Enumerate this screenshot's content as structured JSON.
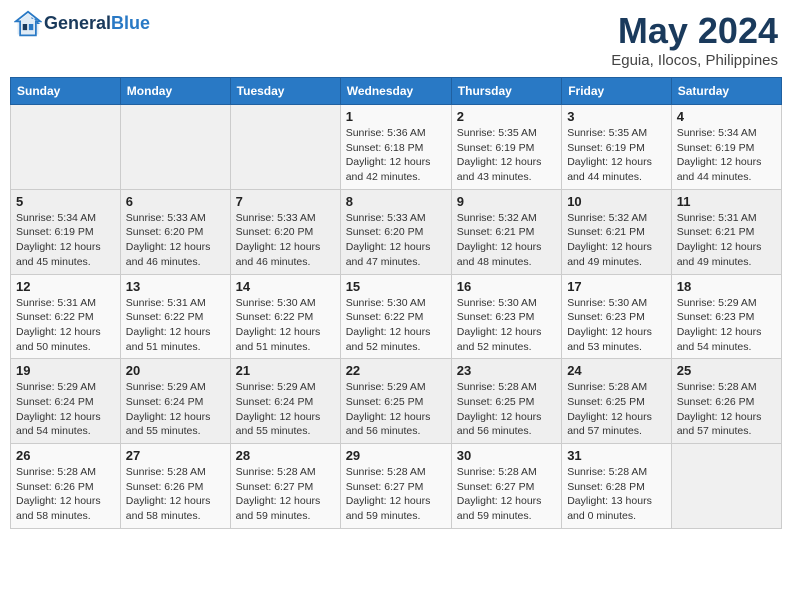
{
  "header": {
    "logo_line1": "General",
    "logo_line2": "Blue",
    "month": "May 2024",
    "location": "Eguia, Ilocos, Philippines"
  },
  "weekdays": [
    "Sunday",
    "Monday",
    "Tuesday",
    "Wednesday",
    "Thursday",
    "Friday",
    "Saturday"
  ],
  "weeks": [
    [
      {
        "day": "",
        "info": ""
      },
      {
        "day": "",
        "info": ""
      },
      {
        "day": "",
        "info": ""
      },
      {
        "day": "1",
        "info": "Sunrise: 5:36 AM\nSunset: 6:18 PM\nDaylight: 12 hours\nand 42 minutes."
      },
      {
        "day": "2",
        "info": "Sunrise: 5:35 AM\nSunset: 6:19 PM\nDaylight: 12 hours\nand 43 minutes."
      },
      {
        "day": "3",
        "info": "Sunrise: 5:35 AM\nSunset: 6:19 PM\nDaylight: 12 hours\nand 44 minutes."
      },
      {
        "day": "4",
        "info": "Sunrise: 5:34 AM\nSunset: 6:19 PM\nDaylight: 12 hours\nand 44 minutes."
      }
    ],
    [
      {
        "day": "5",
        "info": "Sunrise: 5:34 AM\nSunset: 6:19 PM\nDaylight: 12 hours\nand 45 minutes."
      },
      {
        "day": "6",
        "info": "Sunrise: 5:33 AM\nSunset: 6:20 PM\nDaylight: 12 hours\nand 46 minutes."
      },
      {
        "day": "7",
        "info": "Sunrise: 5:33 AM\nSunset: 6:20 PM\nDaylight: 12 hours\nand 46 minutes."
      },
      {
        "day": "8",
        "info": "Sunrise: 5:33 AM\nSunset: 6:20 PM\nDaylight: 12 hours\nand 47 minutes."
      },
      {
        "day": "9",
        "info": "Sunrise: 5:32 AM\nSunset: 6:21 PM\nDaylight: 12 hours\nand 48 minutes."
      },
      {
        "day": "10",
        "info": "Sunrise: 5:32 AM\nSunset: 6:21 PM\nDaylight: 12 hours\nand 49 minutes."
      },
      {
        "day": "11",
        "info": "Sunrise: 5:31 AM\nSunset: 6:21 PM\nDaylight: 12 hours\nand 49 minutes."
      }
    ],
    [
      {
        "day": "12",
        "info": "Sunrise: 5:31 AM\nSunset: 6:22 PM\nDaylight: 12 hours\nand 50 minutes."
      },
      {
        "day": "13",
        "info": "Sunrise: 5:31 AM\nSunset: 6:22 PM\nDaylight: 12 hours\nand 51 minutes."
      },
      {
        "day": "14",
        "info": "Sunrise: 5:30 AM\nSunset: 6:22 PM\nDaylight: 12 hours\nand 51 minutes."
      },
      {
        "day": "15",
        "info": "Sunrise: 5:30 AM\nSunset: 6:22 PM\nDaylight: 12 hours\nand 52 minutes."
      },
      {
        "day": "16",
        "info": "Sunrise: 5:30 AM\nSunset: 6:23 PM\nDaylight: 12 hours\nand 52 minutes."
      },
      {
        "day": "17",
        "info": "Sunrise: 5:30 AM\nSunset: 6:23 PM\nDaylight: 12 hours\nand 53 minutes."
      },
      {
        "day": "18",
        "info": "Sunrise: 5:29 AM\nSunset: 6:23 PM\nDaylight: 12 hours\nand 54 minutes."
      }
    ],
    [
      {
        "day": "19",
        "info": "Sunrise: 5:29 AM\nSunset: 6:24 PM\nDaylight: 12 hours\nand 54 minutes."
      },
      {
        "day": "20",
        "info": "Sunrise: 5:29 AM\nSunset: 6:24 PM\nDaylight: 12 hours\nand 55 minutes."
      },
      {
        "day": "21",
        "info": "Sunrise: 5:29 AM\nSunset: 6:24 PM\nDaylight: 12 hours\nand 55 minutes."
      },
      {
        "day": "22",
        "info": "Sunrise: 5:29 AM\nSunset: 6:25 PM\nDaylight: 12 hours\nand 56 minutes."
      },
      {
        "day": "23",
        "info": "Sunrise: 5:28 AM\nSunset: 6:25 PM\nDaylight: 12 hours\nand 56 minutes."
      },
      {
        "day": "24",
        "info": "Sunrise: 5:28 AM\nSunset: 6:25 PM\nDaylight: 12 hours\nand 57 minutes."
      },
      {
        "day": "25",
        "info": "Sunrise: 5:28 AM\nSunset: 6:26 PM\nDaylight: 12 hours\nand 57 minutes."
      }
    ],
    [
      {
        "day": "26",
        "info": "Sunrise: 5:28 AM\nSunset: 6:26 PM\nDaylight: 12 hours\nand 58 minutes."
      },
      {
        "day": "27",
        "info": "Sunrise: 5:28 AM\nSunset: 6:26 PM\nDaylight: 12 hours\nand 58 minutes."
      },
      {
        "day": "28",
        "info": "Sunrise: 5:28 AM\nSunset: 6:27 PM\nDaylight: 12 hours\nand 59 minutes."
      },
      {
        "day": "29",
        "info": "Sunrise: 5:28 AM\nSunset: 6:27 PM\nDaylight: 12 hours\nand 59 minutes."
      },
      {
        "day": "30",
        "info": "Sunrise: 5:28 AM\nSunset: 6:27 PM\nDaylight: 12 hours\nand 59 minutes."
      },
      {
        "day": "31",
        "info": "Sunrise: 5:28 AM\nSunset: 6:28 PM\nDaylight: 13 hours\nand 0 minutes."
      },
      {
        "day": "",
        "info": ""
      }
    ]
  ]
}
